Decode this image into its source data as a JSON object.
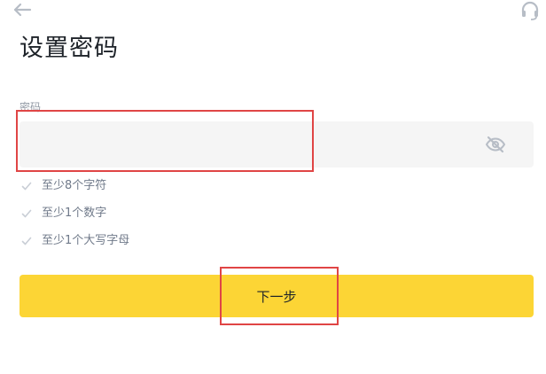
{
  "header": {
    "back_icon": "arrow-left-icon",
    "support_icon": "headset-icon"
  },
  "page": {
    "title": "设置密码"
  },
  "password": {
    "label": "密码",
    "value": "",
    "visibility_icon": "eye-slash-icon"
  },
  "requirements": [
    {
      "label": "至少8个字符",
      "icon": "check-icon"
    },
    {
      "label": "至少1个数字",
      "icon": "check-icon"
    },
    {
      "label": "至少1个大写字母",
      "icon": "check-icon"
    }
  ],
  "actions": {
    "next_label": "下一步"
  },
  "colors": {
    "accent": "#fcd535",
    "highlight": "#e04545",
    "text_primary": "#1e2329",
    "text_secondary": "#707a8a",
    "input_bg": "#f5f5f5"
  }
}
